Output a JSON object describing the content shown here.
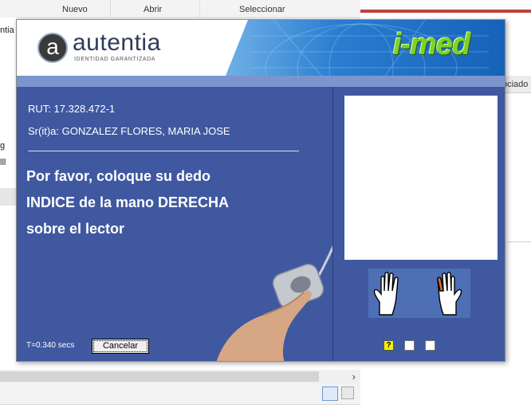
{
  "background_app": {
    "toolbar": [
      "Nuevo",
      "Abrir",
      "Seleccionar"
    ],
    "left_fragments": [
      "ntia",
      "g",
      "lll"
    ],
    "right_header": "ociado"
  },
  "dialog": {
    "logo": {
      "mark": "a",
      "word": "autentia",
      "tagline": "IDENTIDAD GARANTIZADA"
    },
    "brand": "i-med",
    "rut_line": "RUT:  17.328.472-1",
    "name_line": "Sr(it)a:  GONZALEZ FLORES, MARIA JOSE",
    "instruction": [
      "Por favor, coloque su dedo",
      "INDICE de la mano DERECHA",
      "sobre el lector"
    ],
    "timer": "T=0.340 secs",
    "cancel_label": "Cancelar",
    "status_boxes": [
      "?",
      "",
      ""
    ],
    "colors": {
      "panel": "#3f58a0",
      "strip": "#7b95cf",
      "finger_highlight": "#e06a2c",
      "status_yellow": "#f7f200"
    },
    "icons": [
      "hands-icon",
      "fingerprint-reader-icon"
    ]
  }
}
